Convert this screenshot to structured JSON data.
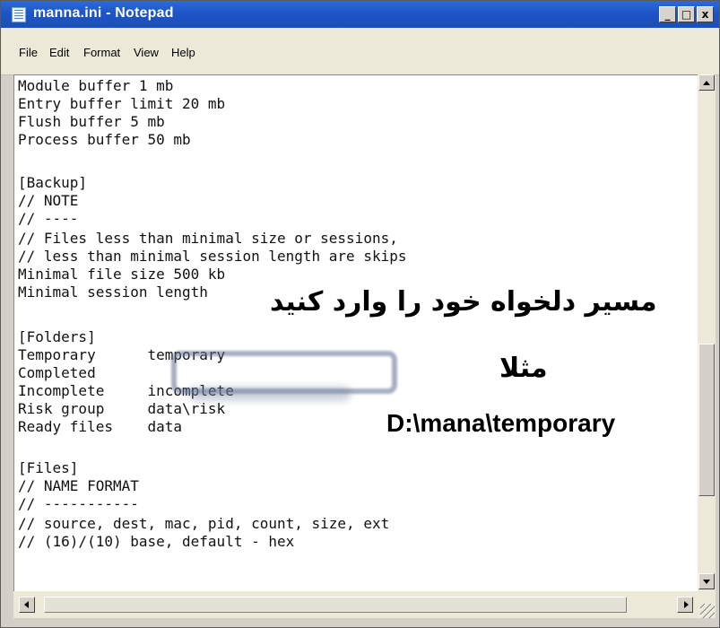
{
  "window": {
    "title": "manna.ini - Notepad"
  },
  "title_controls": [
    "_",
    "□",
    "x"
  ],
  "menu": [
    {
      "label": "File"
    },
    {
      "label": "Edit"
    },
    {
      "label": "Format"
    },
    {
      "label": "View"
    },
    {
      "label": "Help"
    }
  ],
  "lines": [
    "Module buffer 1 mb",
    "Entry buffer limit 20 mb",
    "Flush buffer 5 mb",
    "Process buffer 50 mb",
    "",
    "[Backup]",
    "// NOTE",
    "// ----",
    "// Files less than minimal size or sessions,",
    "// less than minimal session length are skips",
    "Minimal file size 500 kb",
    "Minimal session length",
    "",
    "[Folders]",
    "Temporary      temporary",
    "Completed",
    "Incomplete     incomplete",
    "Risk group     data\\risk",
    "Ready files    data",
    "",
    "[Files]",
    "// NAME FORMAT",
    "// -----------",
    "// source, dest, mac, pid, count, size, ext",
    "// (16)/(10) base, default - hex"
  ],
  "overlay": {
    "instruction": "مسیر دلخواه خود را وارد کنید",
    "example": "مثلا",
    "path": "D:\\mana\\temporary"
  },
  "colors": {
    "titlebar": "#1d55c8",
    "highlight": "#5f6e91"
  }
}
